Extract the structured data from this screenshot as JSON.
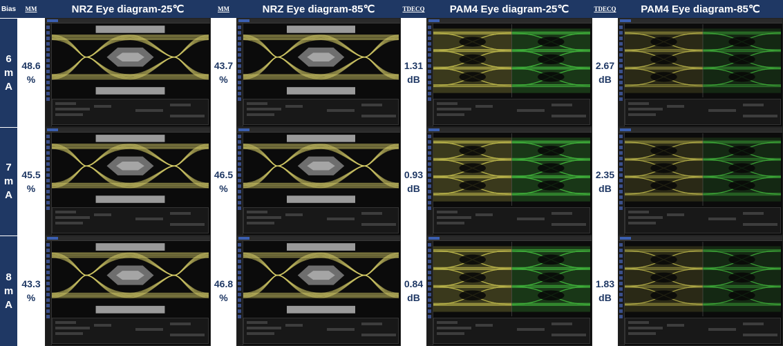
{
  "header": {
    "bias_label": "Bias",
    "columns": [
      {
        "metric_label": "MM",
        "title": "NRZ Eye diagram-25℃"
      },
      {
        "metric_label": "MM",
        "title": "NRZ Eye diagram-85℃"
      },
      {
        "metric_label": "TDECQ",
        "title": "PAM4 Eye diagram-25℃"
      },
      {
        "metric_label": "TDECQ",
        "title": "PAM4 Eye diagram-85℃"
      }
    ]
  },
  "rows": [
    {
      "bias": [
        "6",
        "m",
        "A"
      ],
      "values": [
        [
          "48.6",
          "%"
        ],
        [
          "43.7",
          "%"
        ],
        [
          "1.31",
          "dB"
        ],
        [
          "2.67",
          "dB"
        ]
      ]
    },
    {
      "bias": [
        "7",
        "m",
        "A"
      ],
      "values": [
        [
          "45.5",
          "%"
        ],
        [
          "46.5",
          "%"
        ],
        [
          "0.93",
          "dB"
        ],
        [
          "2.35",
          "dB"
        ]
      ]
    },
    {
      "bias": [
        "8",
        "m",
        "A"
      ],
      "values": [
        [
          "43.3",
          "%"
        ],
        [
          "46.8",
          "%"
        ],
        [
          "0.84",
          "dB"
        ],
        [
          "1.83",
          "dB"
        ]
      ]
    }
  ],
  "colors": {
    "header_bg": "#1f3864",
    "value_text": "#1f3864",
    "nrz_trace": "#d8cf6a",
    "pam4_yellow": "#b7b24a",
    "pam4_green": "#3fae3a",
    "scope_bg": "#0b0b0b"
  }
}
